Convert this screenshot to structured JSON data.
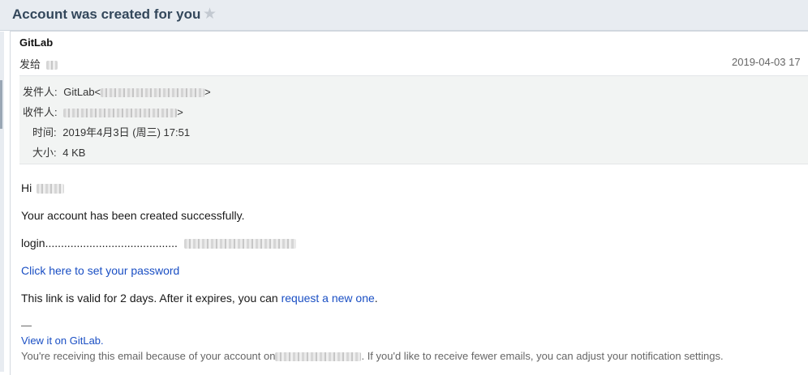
{
  "header": {
    "subject": "Account was created for you",
    "star_icon": "★"
  },
  "message": {
    "sender_name": "GitLab",
    "sent_to_label": "发给",
    "date_short": "2019-04-03 17",
    "meta": {
      "from_label": "发件人:",
      "from_name": "GitLab<",
      "from_close": ">",
      "to_label": "收件人:",
      "to_close": ">",
      "time_label": "时间:",
      "time_value": "2019年4月3日 (周三) 17:51",
      "size_label": "大小:",
      "size_value": "4 KB"
    }
  },
  "body": {
    "greeting": "Hi",
    "created_line": "Your account has been created successfully.",
    "login_label": "login..........................................",
    "set_password_link": "Click here to set your password",
    "validity_prefix": "This link is valid for 2 days. After it expires, you can ",
    "request_link": "request a new one",
    "validity_suffix": "."
  },
  "footer": {
    "separator": "—",
    "view_link": "View it on GitLab.",
    "notice_prefix": "You're receiving this email because of your account on",
    "notice_suffix": ". If you'd like to receive fewer emails, you can adjust your notification settings."
  }
}
